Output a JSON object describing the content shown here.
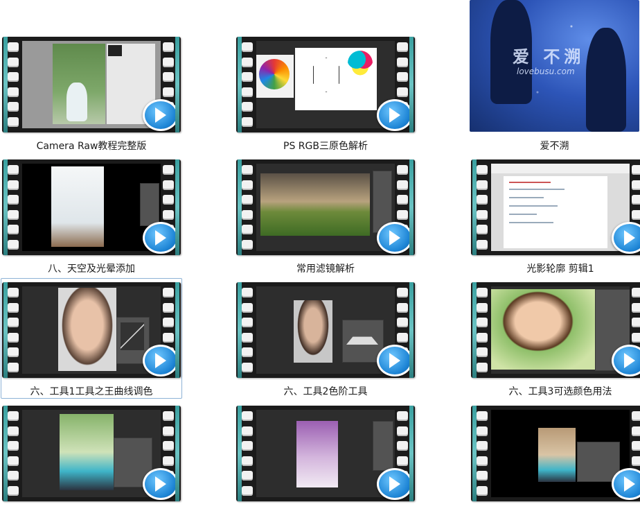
{
  "items": [
    {
      "caption": "Camera Raw教程完整版",
      "type": "video"
    },
    {
      "caption": "PS RGB三原色解析",
      "type": "video"
    },
    {
      "caption": "爱不溯",
      "type": "image",
      "watermark_text": "爱 不溯",
      "watermark_url": "lovebusu.com"
    },
    {
      "caption": "八、天空及光晕添加",
      "type": "video"
    },
    {
      "caption": "常用滤镜解析",
      "type": "video"
    },
    {
      "caption": "光影轮廓 剪辑1",
      "type": "video"
    },
    {
      "caption": "六、工具1工具之王曲线调色",
      "type": "video",
      "selected": true
    },
    {
      "caption": "六、工具2色阶工具",
      "type": "video"
    },
    {
      "caption": "六、工具3可选颜色用法",
      "type": "video"
    },
    {
      "caption": "",
      "type": "video"
    },
    {
      "caption": "",
      "type": "video"
    },
    {
      "caption": "",
      "type": "video"
    }
  ],
  "colors": {
    "selection_border": "#8db2d6",
    "film_edge": "#6cc4c4",
    "play_button": "#1f86d6"
  },
  "icons": [
    "play-icon",
    "film-strip-frame"
  ]
}
